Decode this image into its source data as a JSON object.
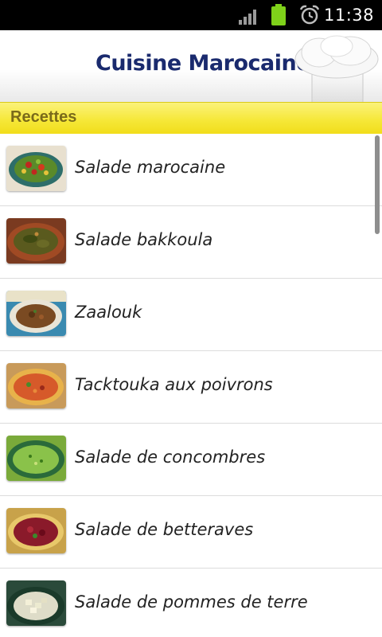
{
  "status_bar": {
    "time": "11:38",
    "icons": [
      "signal-icon",
      "battery-icon",
      "alarm-clock-icon"
    ],
    "colors": {
      "battery": "#7fd11a",
      "background": "#000000"
    }
  },
  "header": {
    "title": "Cuisine Marocaine",
    "logo_icon": "chef-hat-icon",
    "colors": {
      "title": "#1a2a6e"
    }
  },
  "section": {
    "title": "Recettes",
    "colors": {
      "bar": "#f6e83a",
      "text": "#7a6a1a"
    }
  },
  "recipes": [
    {
      "name": "Salade marocaine"
    },
    {
      "name": "Salade bakkoula"
    },
    {
      "name": "Zaalouk"
    },
    {
      "name": "Tacktouka aux poivrons"
    },
    {
      "name": "Salade de concombres"
    },
    {
      "name": "Salade de betteraves"
    },
    {
      "name": "Salade de pommes de terre"
    }
  ]
}
